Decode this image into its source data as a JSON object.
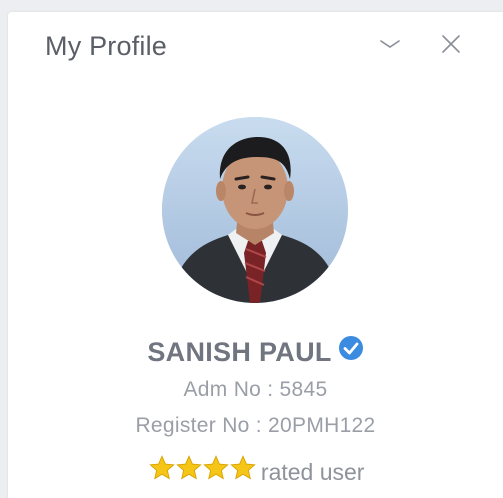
{
  "header": {
    "title": "My Profile",
    "collapse_icon": "chevron-down-icon",
    "close_icon": "close-icon"
  },
  "profile": {
    "avatar": "avatar-photo",
    "name": "SANISH PAUL",
    "verified_icon": "verified-badge-icon",
    "adm_no": "Adm No : 5845",
    "register_no": "Register No : 20PMH122",
    "rating_stars": 4,
    "rating_label": "rated user"
  },
  "colors": {
    "verified": "#3b8be0",
    "star": "#f5c518",
    "text_dark": "#5a5e66",
    "text_muted": "#9a9ea6"
  }
}
